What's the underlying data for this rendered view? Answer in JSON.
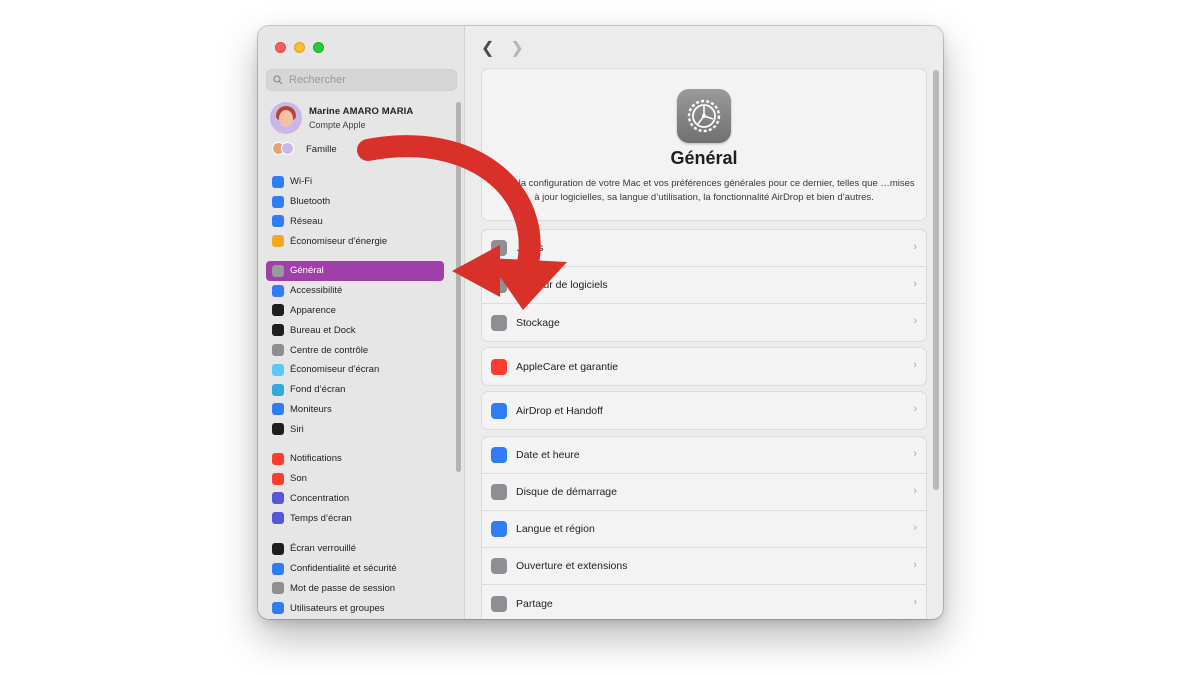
{
  "search": {
    "placeholder": "Rechercher"
  },
  "account": {
    "name": "Marine AMARO MARIA",
    "subtitle": "Compte Apple"
  },
  "family": {
    "label": "Famille"
  },
  "sidebar": {
    "group1": [
      {
        "label": "Wi‑Fi",
        "icon": "wifi-icon",
        "color": "#2f7cf6"
      },
      {
        "label": "Bluetooth",
        "icon": "bluetooth-icon",
        "color": "#2f7cf6"
      },
      {
        "label": "Réseau",
        "icon": "globe-icon",
        "color": "#2f7cf6"
      },
      {
        "label": "Économiseur d’énergie",
        "icon": "battery-icon",
        "color": "#f5a623"
      }
    ],
    "group2": [
      {
        "label": "Général",
        "icon": "gear-icon",
        "color": "#9a9a9a",
        "selected": true
      },
      {
        "label": "Accessibilité",
        "icon": "accessibility-icon",
        "color": "#2f7cf6"
      },
      {
        "label": "Apparence",
        "icon": "appearance-icon",
        "color": "#1e1e1e"
      },
      {
        "label": "Bureau et Dock",
        "icon": "dock-icon",
        "color": "#1e1e1e"
      },
      {
        "label": "Centre de contrôle",
        "icon": "control-center-icon",
        "color": "#8e8e93"
      },
      {
        "label": "Économiseur d’écran",
        "icon": "screensaver-icon",
        "color": "#5ac8fa"
      },
      {
        "label": "Fond d’écran",
        "icon": "wallpaper-icon",
        "color": "#34aadc"
      },
      {
        "label": "Moniteurs",
        "icon": "display-icon",
        "color": "#2f7cf6"
      },
      {
        "label": "Siri",
        "icon": "siri-icon",
        "color": "#1e1e1e"
      }
    ],
    "group3": [
      {
        "label": "Notifications",
        "icon": "notifications-icon",
        "color": "#ff3b30"
      },
      {
        "label": "Son",
        "icon": "sound-icon",
        "color": "#ff3b30"
      },
      {
        "label": "Concentration",
        "icon": "focus-icon",
        "color": "#5856d6"
      },
      {
        "label": "Temps d’écran",
        "icon": "screen-time-icon",
        "color": "#5856d6"
      }
    ],
    "group4": [
      {
        "label": "Écran verrouillé",
        "icon": "lock-screen-icon",
        "color": "#1e1e1e"
      },
      {
        "label": "Confidentialité et sécurité",
        "icon": "privacy-icon",
        "color": "#2f7cf6"
      },
      {
        "label": "Mot de passe de session",
        "icon": "password-icon",
        "color": "#8e8e93"
      },
      {
        "label": "Utilisateurs et groupes",
        "icon": "users-icon",
        "color": "#2f7cf6"
      }
    ]
  },
  "hero": {
    "title": "Général",
    "description": "…rez la configuration de votre Mac et vos préférences générales pour ce dernier, telles que …mises à jour logicielles, sa langue d’utilisation, la fonctionnalité AirDrop et bien d’autres."
  },
  "sections": [
    [
      {
        "label": "…ons",
        "icon": "info-icon",
        "color": "#8e8e93"
      },
      {
        "label": "…à jour de logiciels",
        "icon": "software-update-icon",
        "color": "#8e8e93"
      },
      {
        "label": "Stockage",
        "icon": "storage-icon",
        "color": "#8e8e93"
      }
    ],
    [
      {
        "label": "AppleCare et garantie",
        "icon": "apple-icon",
        "color": "#ff3b30"
      }
    ],
    [
      {
        "label": "AirDrop et Handoff",
        "icon": "airdrop-icon",
        "color": "#2f7cf6"
      }
    ],
    [
      {
        "label": "Date et heure",
        "icon": "calendar-icon",
        "color": "#2f7cf6"
      },
      {
        "label": "Disque de démarrage",
        "icon": "disk-icon",
        "color": "#8e8e93"
      },
      {
        "label": "Langue et région",
        "icon": "globe-icon",
        "color": "#2f7cf6"
      },
      {
        "label": "Ouverture et extensions",
        "icon": "list-icon",
        "color": "#8e8e93"
      },
      {
        "label": "Partage",
        "icon": "sharing-icon",
        "color": "#8e8e93"
      }
    ]
  ],
  "overlay": {
    "arrow_color": "#d9302a"
  }
}
